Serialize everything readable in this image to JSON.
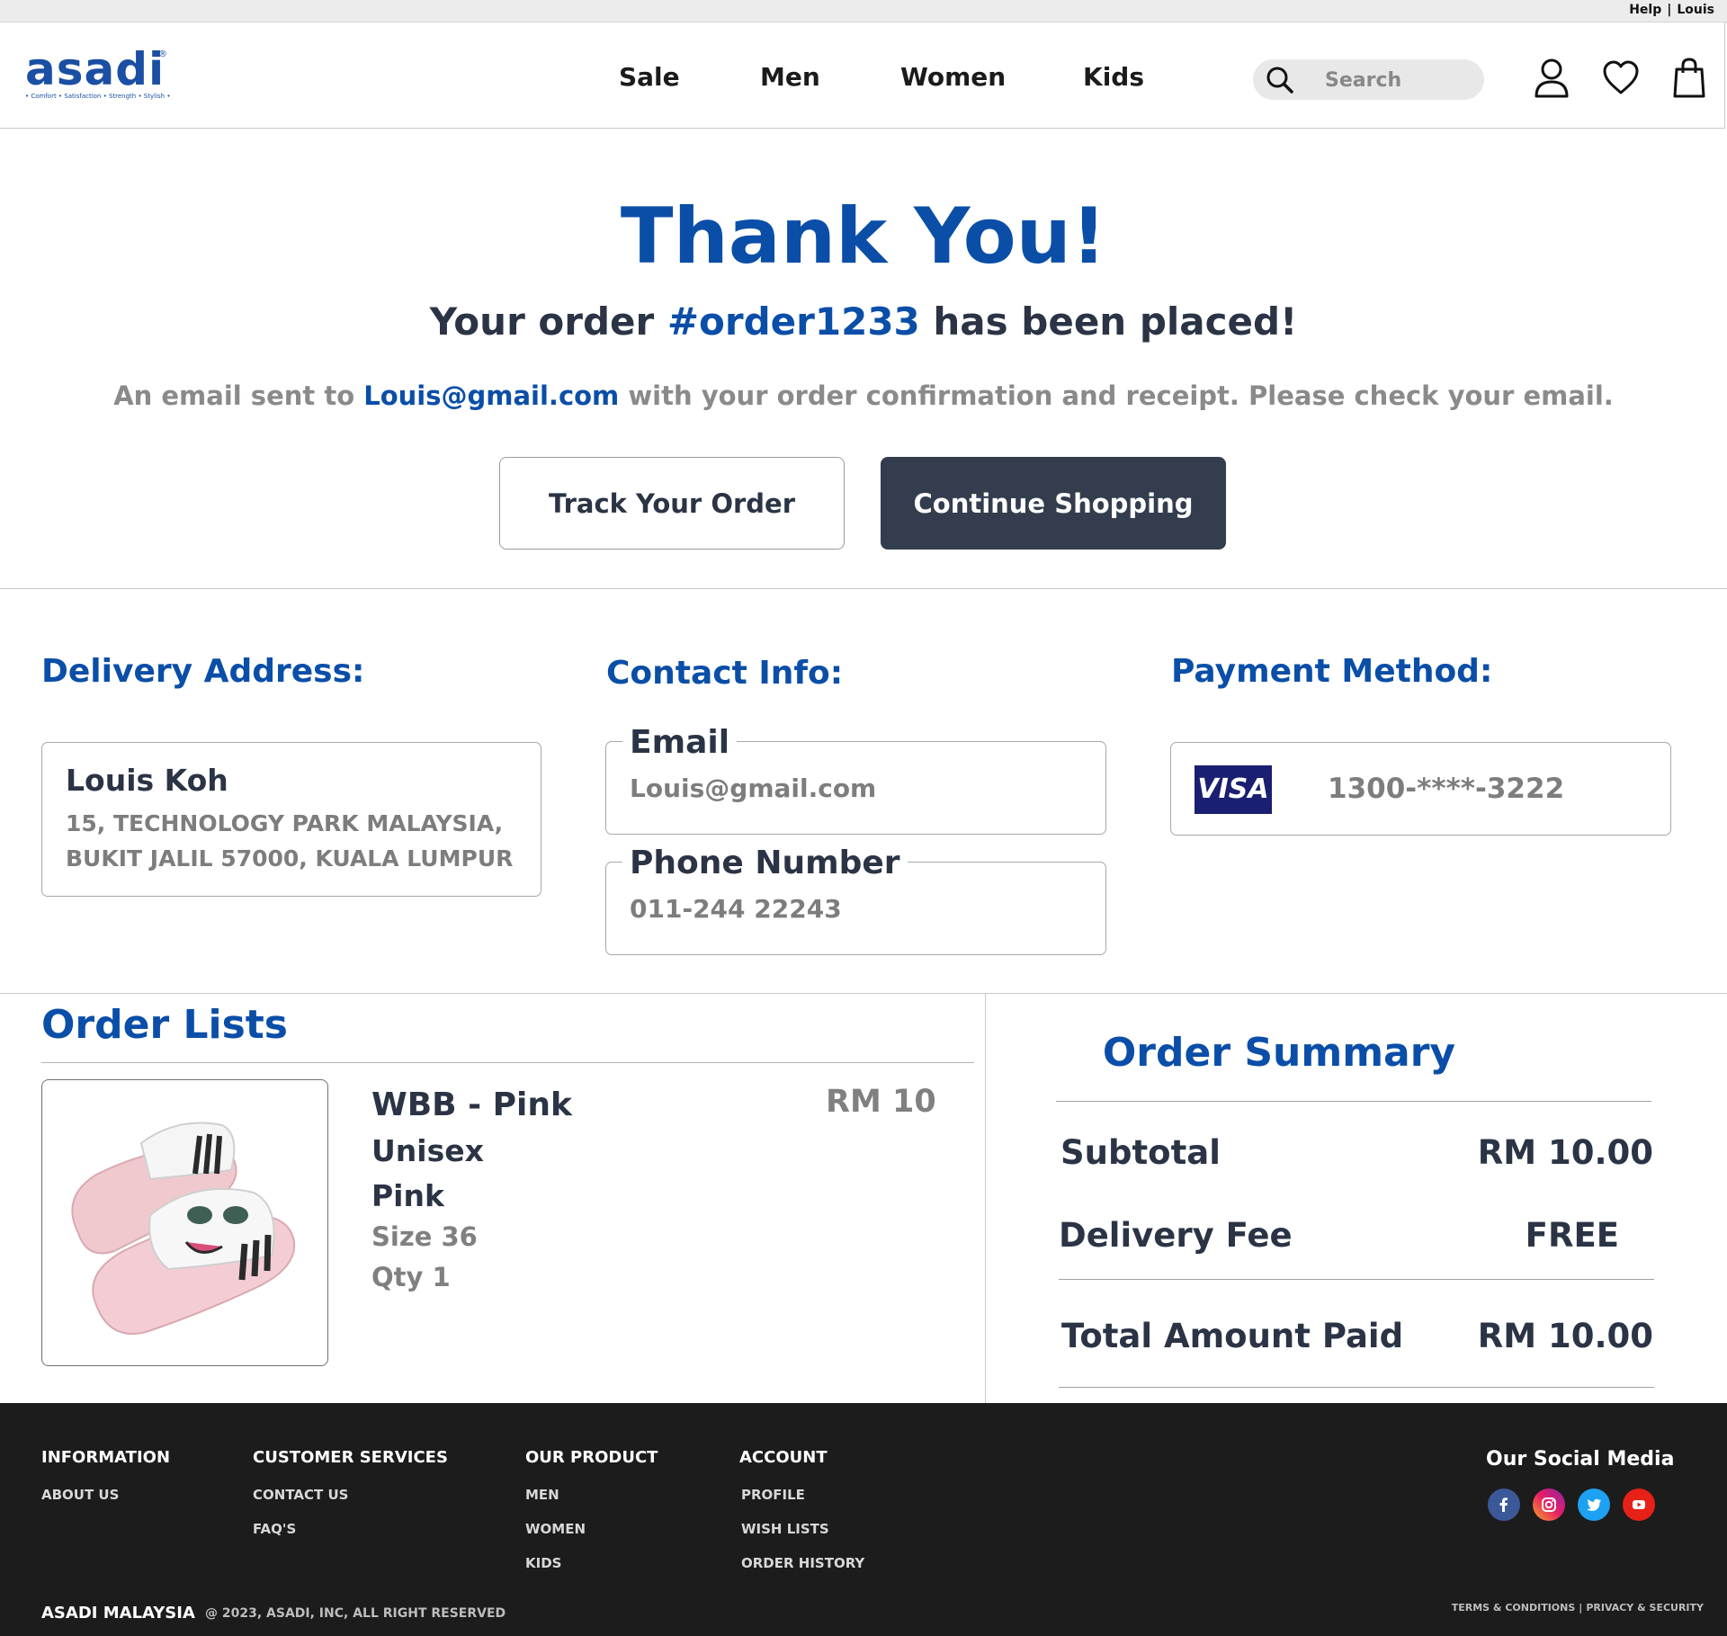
{
  "topbar": {
    "help": "Help",
    "sep": "|",
    "user": "Louis"
  },
  "brand": {
    "logo_text": "asadi",
    "registered": "®",
    "tagline": "• Comfort • Satisfaction • Strength • Stylish •",
    "color": "#1a4fa3"
  },
  "nav": {
    "items": [
      "Sale",
      "Men",
      "Women",
      "Kids"
    ]
  },
  "search": {
    "placeholder": "Search"
  },
  "header_icons": [
    "user-icon",
    "heart-icon",
    "shopping-bag-icon"
  ],
  "thanks": {
    "title": "Thank You!",
    "order_prefix": "Your order",
    "order_id": "#order1233",
    "order_suffix": "has been placed!",
    "email_prefix": "An email sent to",
    "email": "Louis@gmail.com",
    "email_suffix": "with your order confirmation and receipt. Please check your email.",
    "track_button": "Track Your Order",
    "continue_button": "Continue Shopping"
  },
  "delivery": {
    "title": "Delivery Address:",
    "name": "Louis Koh",
    "line1": "15, TECHNOLOGY PARK MALAYSIA,",
    "line2": "BUKIT JALIL 57000, KUALA LUMPUR"
  },
  "contact": {
    "title": "Contact Info:",
    "email_label": "Email",
    "email_value": "Louis@gmail.com",
    "phone_label": "Phone Number",
    "phone_value": "011-244 22243"
  },
  "payment": {
    "title": "Payment Method:",
    "card_brand": "VISA",
    "card_number": "1300-****-3222"
  },
  "orders": {
    "title": "Order Lists",
    "items": [
      {
        "name": "WBB - Pink",
        "gender": "Unisex",
        "color": "Pink",
        "size": "Size 36",
        "qty": "Qty 1",
        "price": "RM 10"
      }
    ]
  },
  "summary": {
    "title": "Order Summary",
    "subtotal_label": "Subtotal",
    "subtotal_value": "RM 10.00",
    "delivery_label": "Delivery Fee",
    "delivery_value": "FREE",
    "total_label": "Total Amount Paid",
    "total_value": "RM 10.00"
  },
  "footer": {
    "information": {
      "title": "INFORMATION",
      "links": [
        "ABOUT US"
      ]
    },
    "customer_services": {
      "title": "CUSTOMER SERVICES",
      "links": [
        "CONTACT US",
        "FAQ'S"
      ]
    },
    "our_product": {
      "title": "OUR PRODUCT",
      "links": [
        "MEN",
        "WOMEN",
        "KIDS"
      ]
    },
    "account": {
      "title": "ACCOUNT",
      "links": [
        "PROFILE",
        "WISH LISTS",
        "ORDER HISTORY"
      ]
    },
    "social_title": "Our Social Media",
    "social_icons": [
      "facebook-icon",
      "instagram-icon",
      "twitter-icon",
      "youtube-icon"
    ],
    "brand": "ASADI MALAYSIA",
    "copyright": "@ 2023, ASADI, INC, ALL RIGHT RESERVED",
    "terms": "TERMS & CONDITIONS",
    "legal_sep": "|",
    "privacy": "PRIVACY & SECURITY"
  },
  "colors": {
    "accent_blue": "#0a4ea8",
    "dark_button": "#333d4d",
    "footer_bg": "#1c1c1c"
  }
}
